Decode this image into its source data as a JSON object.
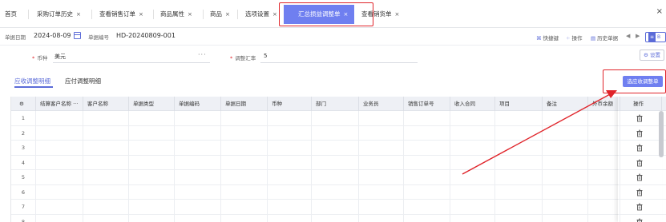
{
  "tabs": [
    {
      "label": "首页",
      "closable": false
    },
    {
      "label": "采购订单历史",
      "closable": true
    },
    {
      "label": "查看销售订单",
      "closable": true
    },
    {
      "label": "商品属性",
      "closable": true
    },
    {
      "label": "商品",
      "closable": true
    },
    {
      "label": "选项设置",
      "closable": true
    },
    {
      "label": "汇总损益调整单",
      "closable": true,
      "active": true
    },
    {
      "label": "查看销货单",
      "closable": true
    }
  ],
  "tab_close_glyph": "×",
  "window_close_glyph": "×",
  "header": {
    "date_label": "单据日期",
    "date_value": "2024-08-09",
    "number_label": "单据编号",
    "number_value": "HD-20240809-001",
    "toolbar": [
      {
        "icon": "shortcut-icon",
        "label": "快捷键"
      },
      {
        "icon": "grid-icon",
        "label": "操作"
      },
      {
        "icon": "history-icon",
        "label": "历史单据"
      }
    ],
    "nav_prev": "◀",
    "nav_next": "▶",
    "more_label": "≡",
    "more_text": "B"
  },
  "form": {
    "currency_label": "币种",
    "currency_value": "美元",
    "currency_ellipsis": "···",
    "rate_label": "调整汇率",
    "rate_value": "5",
    "settings_label": "⚙ 设置"
  },
  "subtabs": [
    {
      "label": "应收调整明细",
      "active": true
    },
    {
      "label": "应付调整明细",
      "active": false
    }
  ],
  "select_button": "选应收调整单",
  "table": {
    "columns": [
      "⚙",
      "结算客户名称 ···",
      "客户名称",
      "单据类型",
      "单据编码",
      "单据日期",
      "币种",
      "部门",
      "业务员",
      "销售订单号",
      "收入合同",
      "项目",
      "备注",
      "外币余额",
      "操作"
    ],
    "row_numbers": [
      "1",
      "2",
      "3",
      "4",
      "5",
      "6",
      "7",
      "8"
    ]
  },
  "colors": {
    "accent": "#6f7ff0",
    "annotation_red": "#e0242a"
  }
}
